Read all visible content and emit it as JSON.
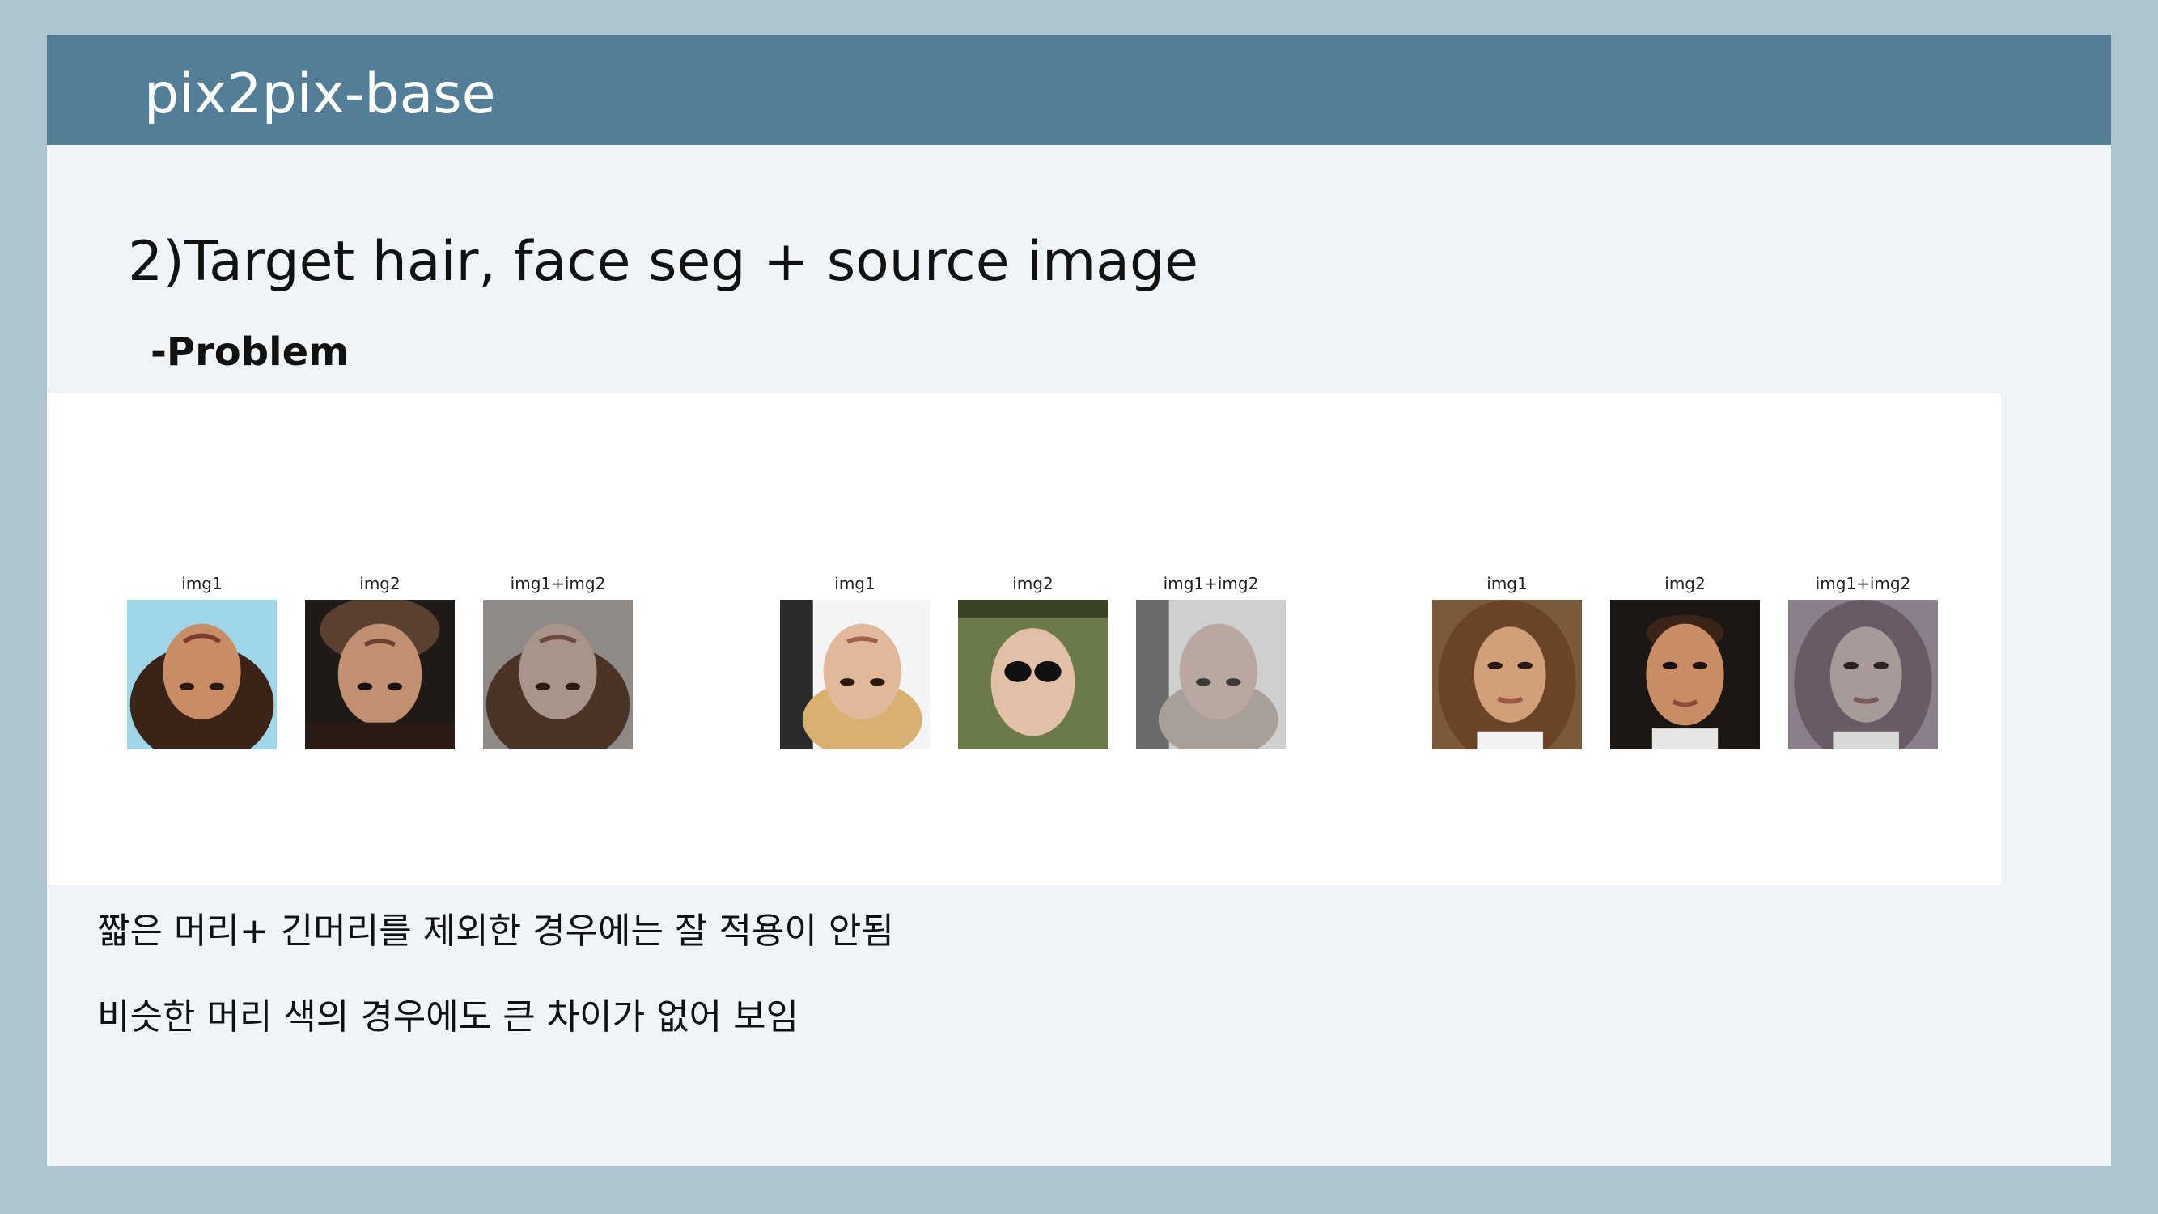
{
  "slide": {
    "title": "pix2pix-base",
    "heading": "2)Target hair, face seg + source image",
    "subheading": "-Problem",
    "notes": [
      "짧은 머리+ 긴머리를 제외한 경우에는 잘 적용이 안됨",
      "비슷한 머리 색의 경우에도 큰 차이가 없어 보임"
    ]
  },
  "figure": {
    "groups": [
      {
        "labels": [
          "img1",
          "img2",
          "img1+img2"
        ],
        "images": [
          "upside-down-face-dark-hair-light-blue-bg",
          "upside-down-face-dark-bg",
          "upside-down-blended-face-gray"
        ]
      },
      {
        "labels": [
          "img1",
          "img2",
          "img1+img2"
        ],
        "images": [
          "upside-down-face-blonde-sign-bg",
          "upside-down-face-sunglasses-green-bg",
          "upside-down-blended-face-pale"
        ]
      },
      {
        "labels": [
          "img1",
          "img2",
          "img1+img2"
        ],
        "images": [
          "woman-face-brown-hair",
          "man-face-dark-bg",
          "blended-face-gray-purple"
        ]
      }
    ],
    "colors": {
      "skin_light": "#e2b89a",
      "skin_tan": "#c98d66",
      "hair_dark": "#3a2418",
      "hair_brown": "#6b4428",
      "blend_gray": "#8f8a86"
    }
  }
}
